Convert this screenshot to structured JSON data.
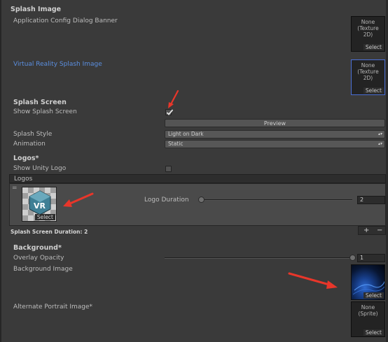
{
  "splash_image": {
    "header": "Splash Image",
    "app_config_banner_label": "Application Config Dialog Banner",
    "vr_splash_label": "Virtual Reality Splash Image",
    "thumb_none_lines": [
      "None",
      "(Texture",
      "2D)"
    ],
    "select_label": "Select"
  },
  "splash_screen": {
    "header": "Splash Screen",
    "show_splash_label": "Show Splash Screen",
    "show_splash_checked": true,
    "preview_button": "Preview",
    "style_label": "Splash Style",
    "style_value": "Light on Dark",
    "animation_label": "Animation",
    "animation_value": "Static"
  },
  "logos": {
    "header": "Logos*",
    "show_unity_logo_label": "Show Unity Logo",
    "show_unity_logo_checked": false,
    "list_header": "Logos",
    "drag_handle": "=",
    "logo_select_label": "Select",
    "logo_duration_label": "Logo Duration",
    "logo_duration_value": "2",
    "logo_duration_fraction": 0.0,
    "duration_summary": "Splash Screen Duration: 2",
    "add_label": "+",
    "remove_label": "−"
  },
  "background": {
    "header": "Background*",
    "overlay_opacity_label": "Overlay Opacity",
    "overlay_opacity_value": "1",
    "overlay_opacity_fraction": 1.0,
    "bg_image_label": "Background Image",
    "alt_portrait_label": "Alternate Portrait Image*",
    "sprite_none_lines": [
      "None",
      "(Sprite)"
    ],
    "select_label": "Select"
  },
  "colors": {
    "panel_bg": "#3a3a3a",
    "link_blue": "#5b8fe0",
    "arrow_red": "#e8362a"
  }
}
